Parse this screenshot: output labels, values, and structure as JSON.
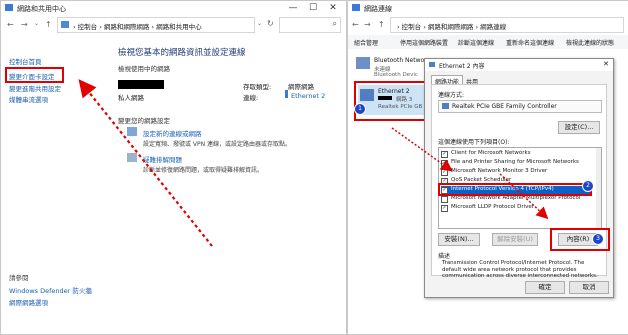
{
  "left": {
    "title": "網路和共用中心",
    "path": [
      "控制台",
      "網路和網際網路",
      "網路和共用中心"
    ],
    "sidebar": {
      "home": "控制台首頁",
      "change_adapter": "變更介面卡設定",
      "change_sharing": "變更進階共用設定",
      "media_stream": "媒體串流選項",
      "see_also": "請參閱",
      "defender": "Windows Defender 防火牆",
      "internet_options": "網際網路選項"
    },
    "heading": "檢視您基本的網路資訊並設定連線",
    "active_networks": "檢視使用中的網路",
    "network_type": "私人網路",
    "access_type_label": "存取類型:",
    "access_type_value": "網際網路",
    "connections_label": "連線:",
    "connections_value": "Ethernet 2",
    "change_settings": "變更您的網路設定",
    "setup_link": "設定新的連線或網路",
    "setup_desc": "設定寬頻、撥號或 VPN 連線，或設定路由器或存取點。",
    "troubleshoot_link": "疑難排解問題",
    "troubleshoot_desc": "診斷並修復網路問題，或取得疑難排解資訊。"
  },
  "right": {
    "title": "網路連線",
    "path": [
      "控制台",
      "網路和網際網路",
      "網路連線"
    ],
    "toolbar": [
      "組合管理",
      "停用這個網路裝置",
      "診斷這個連線",
      "重新命名這個連線",
      "檢視此連線的狀態"
    ],
    "adapters": [
      {
        "name": "Bluetooth Netwo",
        "status": "未連線",
        "device": "Bluetooth Devic"
      },
      {
        "name": "Ethernet 2",
        "status": "網路 3",
        "device": "Realtek PCIe GB"
      }
    ]
  },
  "dialog": {
    "title": "Ethernet 2 內容",
    "tab_network": "網路功能",
    "tab_sharing": "共用",
    "connect_using": "連線方式:",
    "adapter": "Realtek PCIe GBE Family Controller",
    "configure": "設定(C)...",
    "items_label": "這個連線使用下列項目(O):",
    "items": [
      "Client for Microsoft Networks",
      "File and Printer Sharing for Microsoft Networks",
      "Microsoft Network Monitor 3 Driver",
      "QoS Packet Scheduler",
      "Internet Protocol Version 4 (TCP/IPv4)",
      "Microsoft Network Adapter Multiplexor Protocol",
      "Microsoft LLDP Protocol Driver"
    ],
    "install": "安裝(N)...",
    "uninstall": "解除安裝(U)",
    "properties": "內容(R)",
    "desc_label": "描述",
    "description": "Transmission Control Protocol/Internet Protocol. The default wide area network protocol that provides communication across diverse interconnected networks.",
    "ok": "確定",
    "cancel": "取消"
  },
  "badges": [
    "1",
    "2",
    "3"
  ],
  "colors": {
    "annotation_red": "#e00000",
    "badge_blue": "#1e47c7",
    "link_blue": "#1a5fb4",
    "selection": "#0a62c9"
  }
}
